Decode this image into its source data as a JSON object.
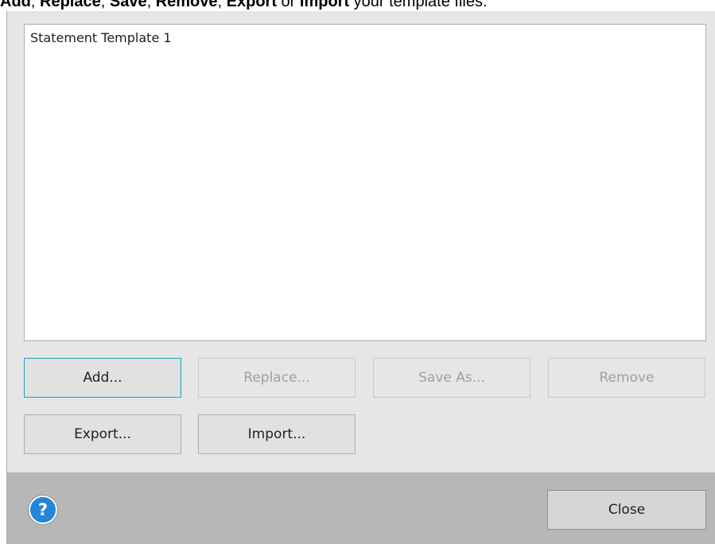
{
  "instruction": {
    "add": "Add",
    "sep1": ", ",
    "replace": "Replace",
    "sep2": ", ",
    "save": "Save",
    "sep3": ", ",
    "remove": "Remove",
    "sep4": ", ",
    "export": "Export",
    "or": " or ",
    "import": "Import",
    "tail": " your template files."
  },
  "templates": {
    "items": [
      "Statement Template 1"
    ]
  },
  "buttons": {
    "add": "Add...",
    "replace": "Replace...",
    "save_as": "Save As...",
    "remove": "Remove",
    "export": "Export...",
    "import": "Import..."
  },
  "footer": {
    "help_glyph": "?",
    "close": "Close"
  },
  "state": {
    "replace_enabled": false,
    "save_as_enabled": false,
    "remove_enabled": false,
    "focused_button": "add"
  },
  "colors": {
    "dialog_bg": "#e6e6e6",
    "footer_bg": "#b7b7b7",
    "focus_border": "#2a9fb3",
    "help_icon_bg": "#2386d9",
    "disabled_text": "#a0a0a0"
  },
  "icons": {
    "help": "help-question-circle-icon"
  }
}
